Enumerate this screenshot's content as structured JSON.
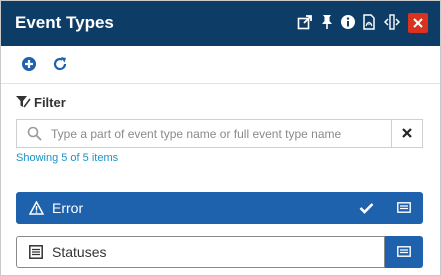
{
  "header": {
    "title": "Event Types",
    "icons": [
      "external-link-icon",
      "pin-icon",
      "info-icon",
      "pdf-icon",
      "resize-icon",
      "close-icon"
    ],
    "close_color": "#d9321f",
    "background": "#0d3d66"
  },
  "toolbar": {
    "icons": [
      "add-icon",
      "refresh-icon"
    ]
  },
  "filter": {
    "label": "Filter",
    "placeholder": "Type a part of event type name or full event type name",
    "value": "",
    "status": "Showing 5 of 5 items"
  },
  "items": [
    {
      "label": "Error",
      "icon": "warning-icon",
      "selected": true
    },
    {
      "label": "Statuses",
      "icon": "list-icon",
      "selected": false
    }
  ],
  "colors": {
    "accent": "#1e62ad",
    "status_text": "#1b93c9"
  }
}
